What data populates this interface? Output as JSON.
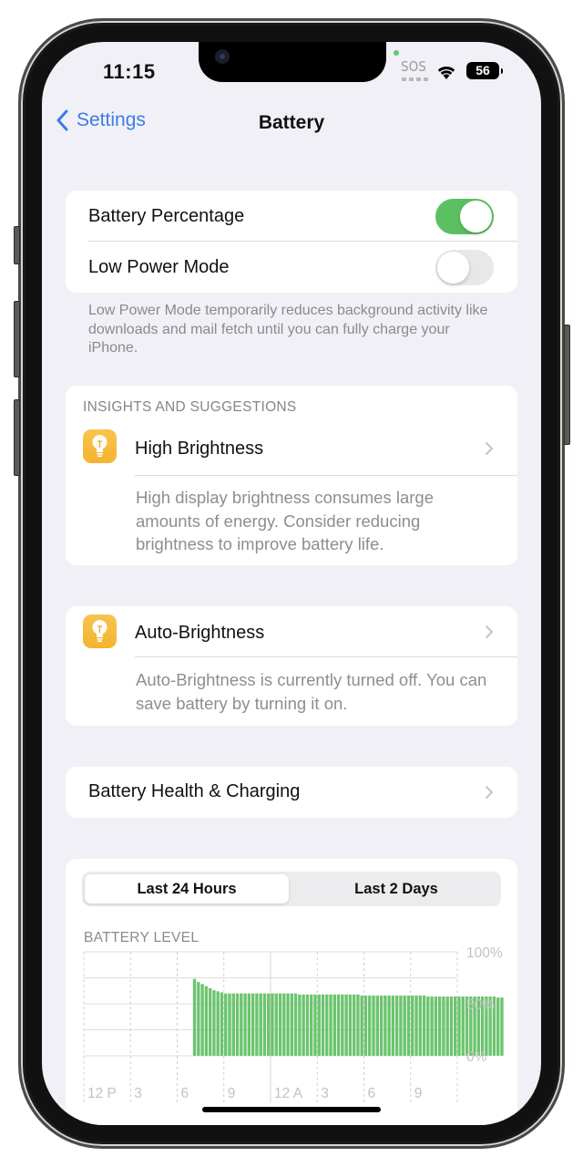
{
  "status_bar": {
    "time": "11:15",
    "signal_label": "SOS",
    "battery_level": "56",
    "wifi_icon": "wifi-icon"
  },
  "nav": {
    "back_label": "Settings",
    "title": "Battery"
  },
  "toggles_group": {
    "items": [
      {
        "label": "Battery Percentage",
        "state": "on"
      },
      {
        "label": "Low Power Mode",
        "state": "off"
      }
    ],
    "footnote": "Low Power Mode temporarily reduces background activity like downloads and mail fetch until you can fully charge your iPhone."
  },
  "insights": {
    "header": "INSIGHTS AND SUGGESTIONS",
    "items": [
      {
        "icon": "lightbulb-icon",
        "title": "High Brightness",
        "description": "High display brightness consumes large amounts of energy. Consider reducing brightness to improve battery life."
      },
      {
        "icon": "lightbulb-icon",
        "title": "Auto-Brightness",
        "description": "Auto-Brightness is currently turned off. You can save battery by turning it on."
      }
    ]
  },
  "battery_health": {
    "label": "Battery Health & Charging"
  },
  "usage": {
    "segments": [
      "Last 24 Hours",
      "Last 2 Days"
    ],
    "selected_segment": 0
  },
  "colors": {
    "accent": "#3a7ee6",
    "toggle_on": "#5cc062",
    "bar": "#6cc46f",
    "icon_yellow": "#f5b93a"
  },
  "chart_data": {
    "type": "bar",
    "title": "BATTERY LEVEL",
    "xlabel": "",
    "ylabel": "",
    "ylim": [
      0,
      100
    ],
    "y_ticks": [
      "100%",
      "50%",
      "0%"
    ],
    "y_tick_values": [
      100,
      50,
      0
    ],
    "x_tick_labels": [
      "12 P",
      "3",
      "6",
      "9",
      "12 A",
      "3",
      "6",
      "9"
    ],
    "x_range_hours": [
      0,
      24
    ],
    "bar_start_hour": 7.0,
    "bar_step_hours": 0.25,
    "grid": true,
    "values": [
      74,
      71,
      69,
      67,
      65,
      63,
      62,
      61,
      60,
      60,
      60,
      60,
      60,
      60,
      60,
      60,
      60,
      60,
      60,
      60,
      60,
      60,
      60,
      60,
      60,
      60,
      60,
      59,
      59,
      59,
      59,
      59,
      59,
      59,
      59,
      59,
      59,
      59,
      59,
      59,
      59,
      59,
      59,
      58,
      58,
      58,
      58,
      58,
      58,
      58,
      58,
      58,
      58,
      58,
      58,
      58,
      58,
      58,
      58,
      58,
      57,
      57,
      57,
      57,
      57,
      57,
      57,
      57,
      57,
      57,
      57,
      57,
      57,
      57,
      57,
      57,
      57,
      57,
      56,
      56
    ]
  }
}
